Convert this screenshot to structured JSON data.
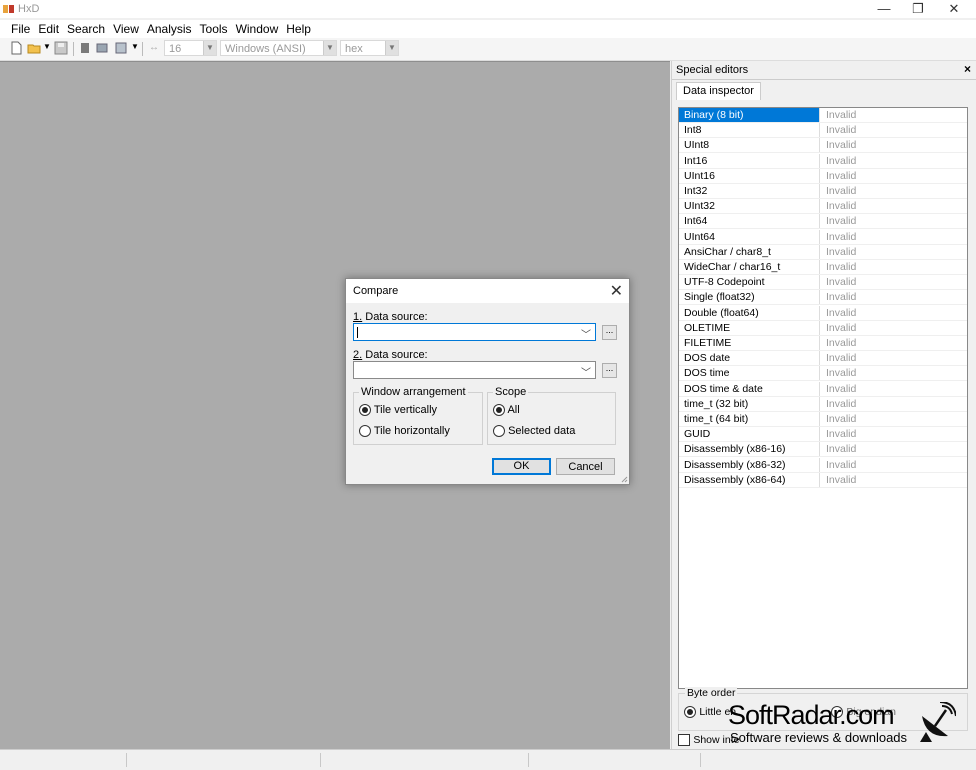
{
  "app": {
    "title": "HxD",
    "colors": {
      "accent": "#0078d7",
      "workspace": "#ababab",
      "panel": "#f0f0f0"
    }
  },
  "window_controls": {
    "minimize": "—",
    "maximize": "❐",
    "close": "✕"
  },
  "menu": [
    "File",
    "Edit",
    "Search",
    "View",
    "Analysis",
    "Tools",
    "Window",
    "Help"
  ],
  "toolbar": {
    "bytes_per_row": "16",
    "encoding": "Windows (ANSI)",
    "offset_base": "hex",
    "icons": [
      "new-file-icon",
      "open-file-icon",
      "save-icon",
      "close-file-icon",
      "open-disk-icon",
      "open-ram-icon"
    ]
  },
  "panel": {
    "title": "Special editors",
    "close": "×",
    "tab": "Data inspector",
    "rows": [
      {
        "type": "Binary (8 bit)",
        "value": "Invalid"
      },
      {
        "type": "Int8",
        "value": "Invalid"
      },
      {
        "type": "UInt8",
        "value": "Invalid"
      },
      {
        "type": "Int16",
        "value": "Invalid"
      },
      {
        "type": "UInt16",
        "value": "Invalid"
      },
      {
        "type": "Int32",
        "value": "Invalid"
      },
      {
        "type": "UInt32",
        "value": "Invalid"
      },
      {
        "type": "Int64",
        "value": "Invalid"
      },
      {
        "type": "UInt64",
        "value": "Invalid"
      },
      {
        "type": "AnsiChar / char8_t",
        "value": "Invalid"
      },
      {
        "type": "WideChar / char16_t",
        "value": "Invalid"
      },
      {
        "type": "UTF-8 Codepoint",
        "value": "Invalid"
      },
      {
        "type": "Single (float32)",
        "value": "Invalid"
      },
      {
        "type": "Double (float64)",
        "value": "Invalid"
      },
      {
        "type": "OLETIME",
        "value": "Invalid"
      },
      {
        "type": "FILETIME",
        "value": "Invalid"
      },
      {
        "type": "DOS date",
        "value": "Invalid"
      },
      {
        "type": "DOS time",
        "value": "Invalid"
      },
      {
        "type": "DOS time & date",
        "value": "Invalid"
      },
      {
        "type": "time_t (32 bit)",
        "value": "Invalid"
      },
      {
        "type": "time_t (64 bit)",
        "value": "Invalid"
      },
      {
        "type": "GUID",
        "value": "Invalid"
      },
      {
        "type": "Disassembly (x86-16)",
        "value": "Invalid"
      },
      {
        "type": "Disassembly (x86-32)",
        "value": "Invalid"
      },
      {
        "type": "Disassembly (x86-64)",
        "value": "Invalid"
      }
    ],
    "byte_order": {
      "label": "Byte order",
      "little_endian": "Little en",
      "big_endian": "Big endian",
      "show_integers": "Show inte"
    }
  },
  "watermark": {
    "name": "SoftRadar.com",
    "tagline": "Software reviews & downloads"
  },
  "dialog": {
    "title": "Compare",
    "close": "✕",
    "source1_label": "Data source:",
    "source1_num": "1.",
    "source2_label": "Data source:",
    "source2_num": "2.",
    "browse": "...",
    "window_arrangement": {
      "label": "Window arrangement",
      "options": [
        "Tile vertically",
        "Tile horizontally"
      ],
      "selected": "Tile vertically"
    },
    "scope": {
      "label": "Scope",
      "options": [
        "All",
        "Selected data"
      ],
      "selected": "All"
    },
    "ok": "OK",
    "cancel": "Cancel"
  }
}
